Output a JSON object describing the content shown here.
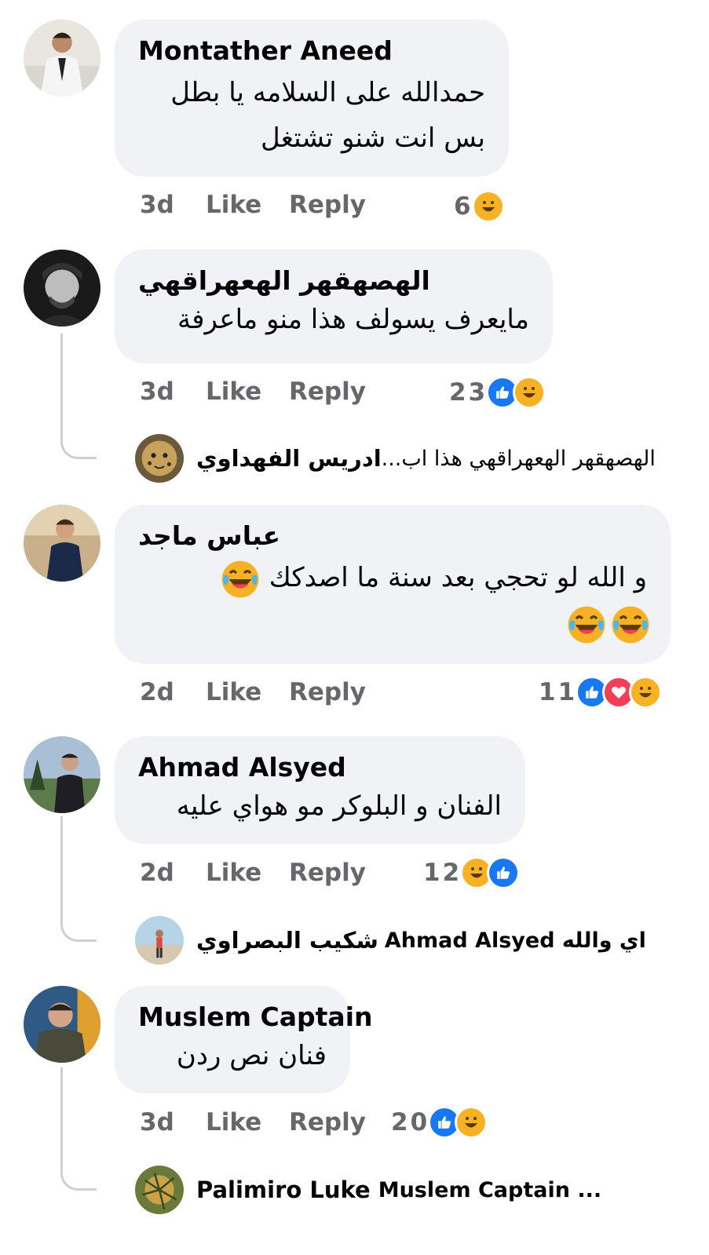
{
  "comments": [
    {
      "name": "Montather Aneed",
      "lines": [
        "حمدالله على السلامه يا بطل",
        "بس انت شنو تشتغل"
      ],
      "time": "3d",
      "like": "Like",
      "reply": "Reply",
      "reaction_count": "6",
      "reactions": [
        "haha"
      ]
    },
    {
      "name": "الهصهقهر الهعهراقهي",
      "lines": [
        "مايعرف يسولف هذا منو ماعرفة"
      ],
      "time": "3d",
      "like": "Like",
      "reply": "Reply",
      "reaction_count": "23",
      "reactions": [
        "like",
        "haha"
      ],
      "reply_preview": {
        "author": "ادريس الفهداوي",
        "text": "الهصهقهر الهعهراقهي هذا اب..."
      }
    },
    {
      "name": "عباس ماجد",
      "lines": [
        "و الله لو تحجي بعد سنة ما اصدكك"
      ],
      "time": "2d",
      "like": "Like",
      "reply": "Reply",
      "reaction_count": "11",
      "reactions": [
        "like",
        "love",
        "haha"
      ]
    },
    {
      "name": "Ahmad Alsyed",
      "lines": [
        "الفنان و البلوكر مو هواي عليه"
      ],
      "time": "2d",
      "like": "Like",
      "reply": "Reply",
      "reaction_count": "12",
      "reactions": [
        "haha",
        "like"
      ],
      "reply_preview": {
        "author": "شكيب البصراوي",
        "text": "Ahmad Alsyed اي والله"
      }
    },
    {
      "name": "Muslem Captain",
      "lines": [
        "فنان نص ردن"
      ],
      "time": "3d",
      "like": "Like",
      "reply": "Reply",
      "reaction_count": "20",
      "reactions": [
        "like",
        "haha"
      ],
      "reply_preview": {
        "author": "Palimiro Luke",
        "text": "Muslem Captain ..."
      }
    }
  ],
  "icons": [
    "haha-emoji-icon",
    "like-reaction-icon",
    "love-reaction-icon",
    "laughing-crying-emoji-icon"
  ]
}
